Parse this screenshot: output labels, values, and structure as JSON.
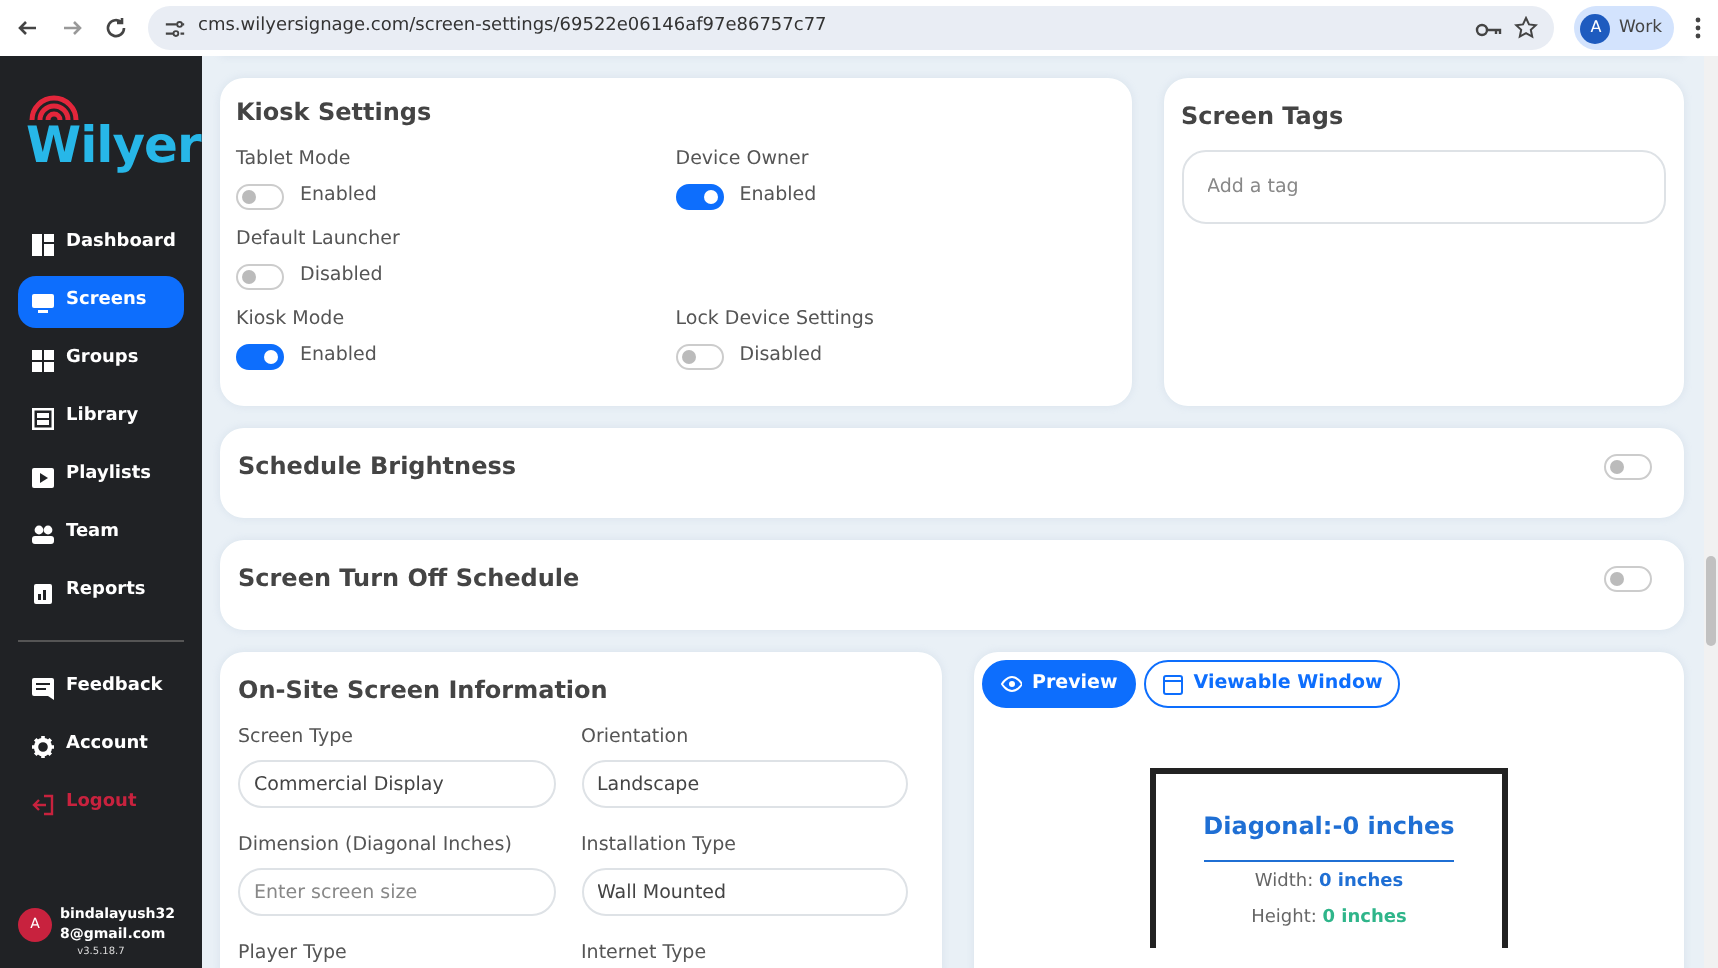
{
  "browser": {
    "url": "cms.wilyersignage.com/screen-settings/69522e06146af97e86757c77",
    "profile_initial": "A",
    "profile_label": "Work"
  },
  "sidebar": {
    "logo": "Wilyer",
    "items": [
      {
        "label": "Dashboard",
        "selected": false,
        "kind": "nav"
      },
      {
        "label": "Screens",
        "selected": true,
        "kind": "nav"
      },
      {
        "label": "Groups",
        "selected": false,
        "kind": "nav"
      },
      {
        "label": "Library",
        "selected": false,
        "kind": "nav"
      },
      {
        "label": "Playlists",
        "selected": false,
        "kind": "nav"
      },
      {
        "label": "Team",
        "selected": false,
        "kind": "nav"
      },
      {
        "label": "Reports",
        "selected": false,
        "kind": "nav"
      },
      {
        "label": "Feedback",
        "selected": false,
        "kind": "nav"
      },
      {
        "label": "Account",
        "selected": false,
        "kind": "nav"
      },
      {
        "label": "Logout",
        "selected": false,
        "kind": "danger"
      }
    ],
    "user": {
      "initial": "A",
      "email": "bindalayush328@gmail.com"
    },
    "version": "v3.5.18.7"
  },
  "kiosk_settings": {
    "title": "Kiosk Settings",
    "settings": [
      {
        "label": "Tablet Mode",
        "state_text": "Enabled",
        "on": false
      },
      {
        "label": "Device Owner",
        "state_text": "Enabled",
        "on": true
      },
      {
        "label": "Default Launcher",
        "state_text": "Disabled",
        "on": false
      },
      {
        "label": "Kiosk Mode",
        "state_text": "Enabled",
        "on": true
      },
      {
        "label": "Lock Device Settings",
        "state_text": "Disabled",
        "on": false
      }
    ]
  },
  "screen_tags": {
    "title": "Screen Tags",
    "placeholder": "Add a tag"
  },
  "toggle_sections": [
    {
      "title": "Schedule Brightness",
      "on": false
    },
    {
      "title": "Screen Turn Off Schedule",
      "on": false
    }
  ],
  "screen_info": {
    "title": "On-Site Screen Information",
    "fields": [
      {
        "label": "Screen Type",
        "value": "Commercial Display"
      },
      {
        "label": "Orientation",
        "value": "Landscape"
      },
      {
        "label": "Dimension (Diagonal Inches)",
        "placeholder": "Enter screen size"
      },
      {
        "label": "Installation Type",
        "value": "Wall Mounted"
      },
      {
        "label": "Player Type"
      },
      {
        "label": "Internet Type"
      }
    ]
  },
  "preview": {
    "tabs": [
      {
        "label": "Preview",
        "selected": true
      },
      {
        "label": "Viewable Window",
        "selected": false
      }
    ],
    "diagonal": "Diagonal:-0 inches",
    "width_label": "Width:",
    "width_value": "0 inches",
    "height_label": "Height:",
    "height_value": "0 inches"
  }
}
